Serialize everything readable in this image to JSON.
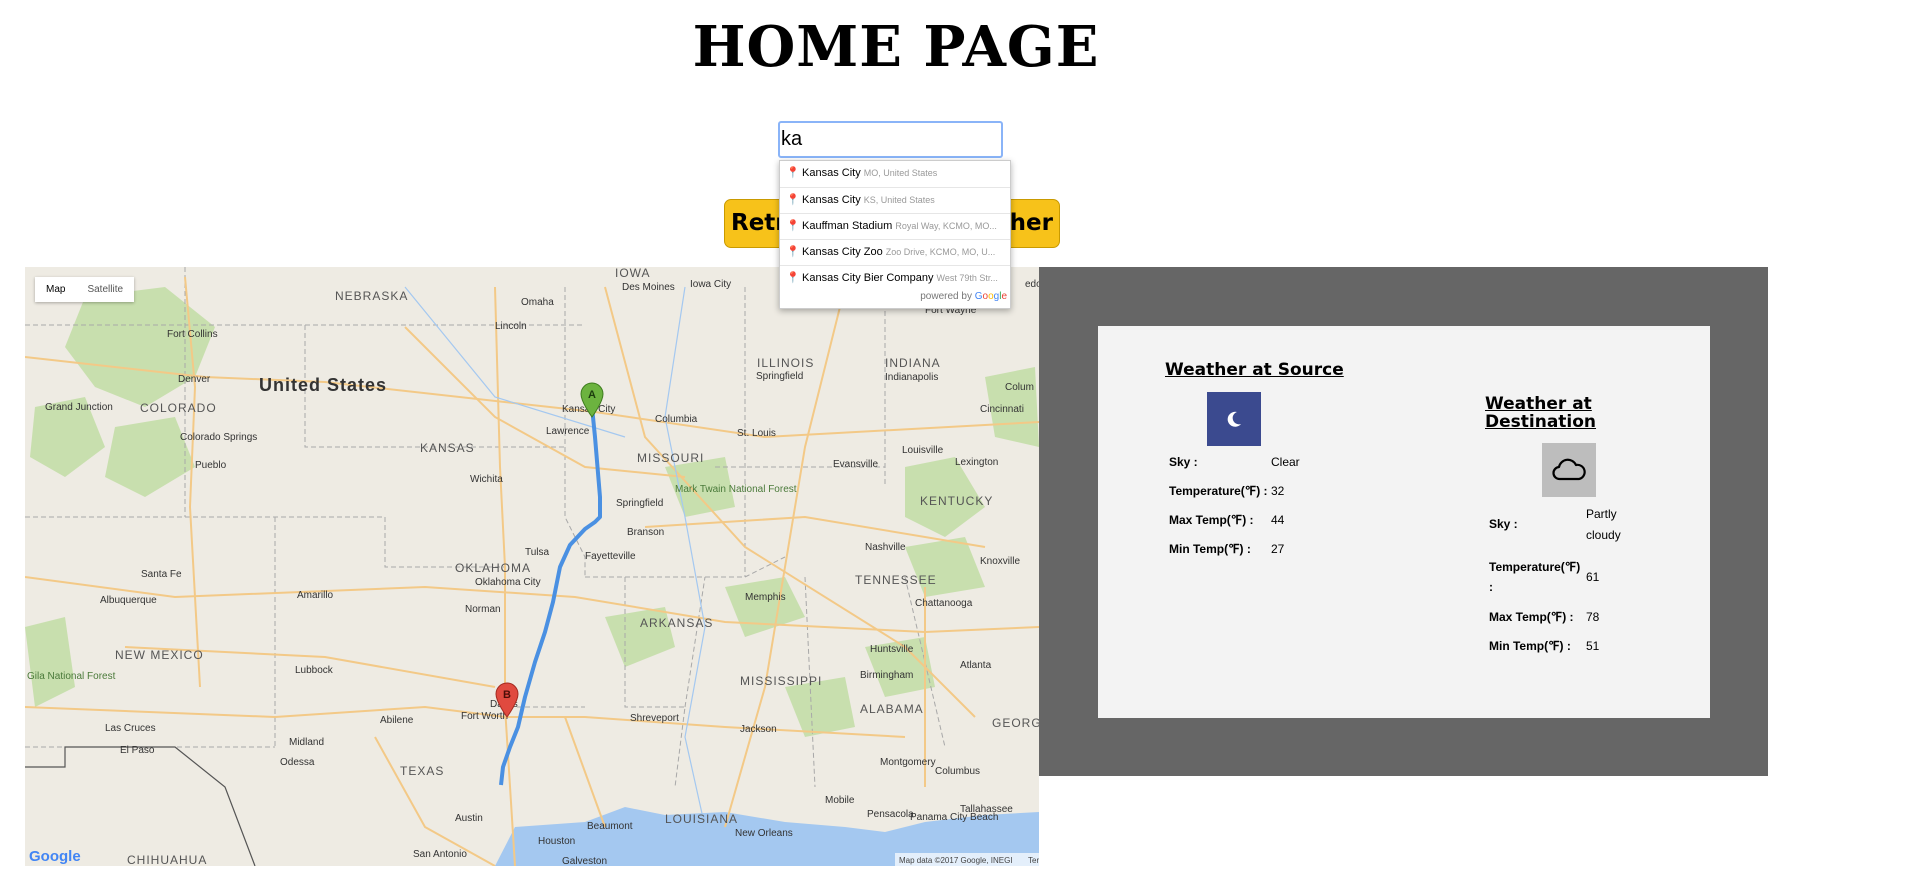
{
  "page": {
    "title": "HOME PAGE"
  },
  "search": {
    "value": "ka"
  },
  "button": {
    "label_left": "Retri",
    "label_right": "ther"
  },
  "autocomplete": {
    "items": [
      {
        "main": "Kansas City",
        "secondary": "MO, United States"
      },
      {
        "main": "Kansas City",
        "secondary": "KS, United States"
      },
      {
        "main": "Kauffman Stadium",
        "secondary": "Royal Way, KCMO, MO..."
      },
      {
        "main": "Kansas City Zoo",
        "secondary": "Zoo Drive, KCMO, MO, U..."
      },
      {
        "main": "Kansas City Bier Company",
        "secondary": "West 79th Str..."
      }
    ],
    "footer": "powered by"
  },
  "map": {
    "type_control": {
      "map": "Map",
      "satellite": "Satellite"
    },
    "labels": {
      "united_states": "United States",
      "nebraska": "NEBRASKA",
      "iowa": "IOWA",
      "kansas": "KANSAS",
      "missouri": "MISSOURI",
      "illinois": "ILLINOIS",
      "indiana": "INDIANA",
      "kentucky": "KENTUCKY",
      "tennessee": "TENNESSEE",
      "oklahoma": "OKLAHOMA",
      "arkansas": "ARKANSAS",
      "mississippi": "MISSISSIPPI",
      "alabama": "ALABAMA",
      "georgia": "GEORGI",
      "texas": "TEXAS",
      "louisiana": "LOUISIANA",
      "new_mexico": "NEW MEXICO",
      "colorado": "COLORADO",
      "chihuahua": "CHIHUAHUA",
      "omaha": "Omaha",
      "lincoln": "Lincoln",
      "des_moines": "Des Moines",
      "iowa_city": "Iowa City",
      "kansas_city": "Kansas City",
      "lawrence": "Lawrence",
      "columbia": "Columbia",
      "st_louis": "St. Louis",
      "springfield_il": "Springfield",
      "indianapolis": "Indianapolis",
      "cincinnati": "Cincinnati",
      "louisville": "Louisville",
      "lexington": "Lexington",
      "evansville": "Evansville",
      "springfield_mo": "Springfield",
      "branson": "Branson",
      "mark_twain": "Mark Twain National Forest",
      "wichita": "Wichita",
      "tulsa": "Tulsa",
      "fayetteville": "Fayetteville",
      "oklahoma_city": "Oklahoma City",
      "norman": "Norman",
      "nashville": "Nashville",
      "knoxville": "Knoxville",
      "memphis": "Memphis",
      "chattanooga": "Chattanooga",
      "huntsville": "Huntsville",
      "birmingham": "Birmingham",
      "atlanta": "Atlanta",
      "jackson": "Jackson",
      "montgomery": "Montgomery",
      "columbus": "Columbus",
      "shreveport": "Shreveport",
      "dallas": "Dallas",
      "fort_worth": "Fort Worth",
      "abilene": "Abilene",
      "midland": "Midland",
      "odessa": "Odessa",
      "lubbock": "Lubbock",
      "amarillo": "Amarillo",
      "austin": "Austin",
      "san_antonio": "San Antonio",
      "houston": "Houston",
      "beaumont": "Beaumont",
      "galveston": "Galveston",
      "new_orleans": "New Orleans",
      "mobile": "Mobile",
      "pensacola": "Pensacola",
      "panama_city": "Panama City Beach",
      "tallahassee": "Tallahassee",
      "albuquerque": "Albuquerque",
      "santa_fe": "Santa Fe",
      "gila": "Gila National Forest",
      "las_cruces": "Las Cruces",
      "el_paso": "El Paso",
      "denver": "Denver",
      "fort_collins": "Fort Collins",
      "colorado_springs": "Colorado Springs",
      "pueblo": "Pueblo",
      "grand_junction": "Grand Junction",
      "fort_wayne": "Fort Wayne",
      "toledo": "edo",
      "columbus_oh": "Colum"
    },
    "marker_a": "A",
    "marker_b": "B",
    "logo": "Google",
    "attribution": "Map data ©2017 Google, INEGI",
    "terms": "Ter"
  },
  "weather_source": {
    "title": "Weather at Source",
    "icon": "moon-icon",
    "icon_bg": "#3b4a8f",
    "rows": [
      {
        "label": "Sky :",
        "value": "Clear"
      },
      {
        "label": "Temperature(℉) :",
        "value": "32"
      },
      {
        "label": "Max Temp(℉) :",
        "value": "44"
      },
      {
        "label": "Min Temp(℉) :",
        "value": "27"
      }
    ]
  },
  "weather_destination": {
    "title_line1": "Weather at",
    "title_line2": "Destination",
    "icon": "cloud-icon",
    "icon_bg": "#bdbdbd",
    "sky_label": "Sky :",
    "sky_value_line1": "Partly",
    "sky_value_line2": "cloudy",
    "temp_label_line1": "Temperature(℉)",
    "temp_label_line2": ":",
    "temp_value": "61",
    "max_label": "Max Temp(℉) :",
    "max_value": "78",
    "min_label": "Min Temp(℉) :",
    "min_value": "51"
  },
  "colors": {
    "button": "#f7c21a",
    "panel": "#666666",
    "card": "#f3f3f3",
    "route": "#4a90e2",
    "marker_a": "#6cb33f",
    "marker_b": "#e04a3f"
  }
}
